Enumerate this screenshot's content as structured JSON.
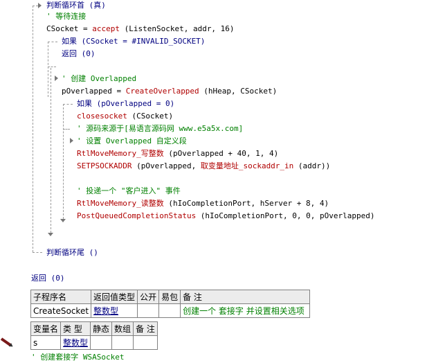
{
  "code": {
    "loop_head": "判断循环首 (真)",
    "c_wait": "' 等待连接",
    "accept_pre": "CSocket = ",
    "accept_fn": "accept",
    "accept_args": " (ListenSocket, addr, 16)",
    "if1": "如果 (CSocket = #INVALID_SOCKET)",
    "return0": "返回 (0)",
    "c_create": "' 创建 Overlapped",
    "ov_pre": "pOverlapped = ",
    "ov_fn": "CreateOverlapped",
    "ov_args": " (hHeap, CSocket)",
    "if2": "如果 (pOverlapped = 0)",
    "close_fn": "closesocket",
    "close_args": " (CSocket)",
    "c_source": "' 源码来源于[易语言源码网 www.e5a5x.com]",
    "c_setov": "' 设置 Overlapped 自定义段",
    "rtl_write_fn": "RtlMoveMemory_写整数",
    "rtl_write_args": " (pOverlapped + 40, 1, 4)",
    "set_fn": "SETPSOCKADDR",
    "set_args_a": " (pOverlapped, ",
    "set_inner_fn": "取变量地址_sockaddr_in",
    "set_args_b": " (addr))",
    "c_post": "' 投递一个 \"客户进入\" 事件",
    "rtl_read_fn": "RtlMoveMemory_读整数",
    "rtl_read_args": " (hIoCompletionPort, hServer + 8, 4)",
    "post_fn": "PostQueuedCompletionStatus",
    "post_args": " (hIoCompletionPort, 0, 0, pOverlapped)",
    "loop_tail": "判断循环尾 ()",
    "return_final": "返回 (0)",
    "c_bottom": "' 创建套接字 WSASocket"
  },
  "sub_table": {
    "headers": [
      "子程序名",
      "返回值类型",
      "公开",
      "易包",
      "备 注"
    ],
    "row": {
      "name": "CreateSocket",
      "return_type": "整数型",
      "public": "",
      "pkg": "",
      "note": "创建一个 套接字 并设置相关选项"
    }
  },
  "var_table": {
    "headers": [
      "变量名",
      "类 型",
      "静态",
      "数组",
      "备 注"
    ],
    "row": {
      "name": "s",
      "type": "整数型",
      "static": "",
      "array": "",
      "note": ""
    }
  },
  "colors": {
    "keyword": "#000080",
    "function": "#b00000",
    "comment": "#008000"
  }
}
